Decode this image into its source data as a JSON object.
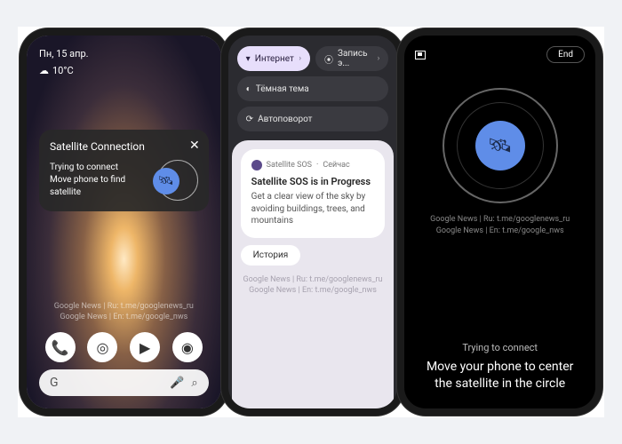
{
  "left": {
    "date": "Пн, 15 апр.",
    "weather_icon": "☁",
    "temp": "10°C",
    "card": {
      "title": "Satellite Connection",
      "line1": "Trying to connect",
      "line2": "Move phone to find satellite",
      "close": "✕"
    },
    "watermark1": "Google News | Ru: t.me/googlenews_ru",
    "watermark2": "Google News | En: t.me/google_nws",
    "dock": {
      "phone": "📞",
      "chrome": "◎",
      "play": "▶",
      "camera": "◉"
    },
    "search": {
      "g": "G",
      "mic": "🎤",
      "lens": "⌕"
    }
  },
  "mid": {
    "chips": {
      "internet": "Интернет",
      "record": "Запись э...",
      "dark": "Тёмная тема",
      "rotate": "Автоповорот"
    },
    "notif": {
      "app": "Satellite SOS",
      "sep": "·",
      "time": "Сейчас",
      "title": "Satellite SOS is in Progress",
      "body": "Get a clear view of the sky by avoiding buildings, trees, and mountains"
    },
    "history": "История",
    "watermark1": "Google News | Ru: t.me/googlenews_ru",
    "watermark2": "Google News | En: t.me/google_nws"
  },
  "right": {
    "end": "End",
    "watermark1": "Google News | Ru: t.me/googlenews_ru",
    "watermark2": "Google News | En: t.me/google_nws",
    "status": "Trying to connect",
    "instruction": "Move your phone to center the satellite in the circle"
  },
  "icons": {
    "wifi": "▾",
    "target": "⦿",
    "moon": "◐",
    "rotate": "⟳",
    "satellite": "🛰"
  }
}
